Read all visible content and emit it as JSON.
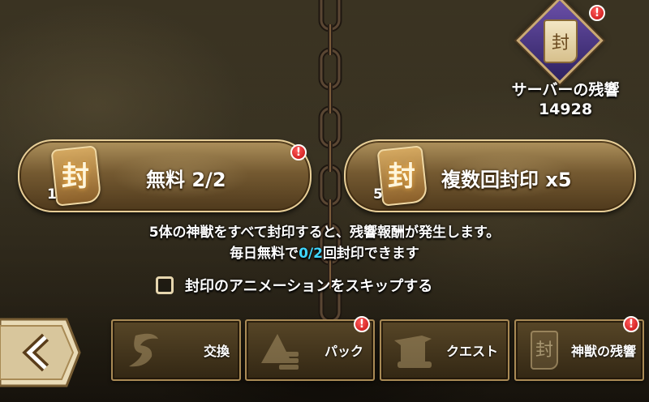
{
  "emblem": {
    "title": "サーバーの残響",
    "count": "14928",
    "kanji": "封",
    "alert": "!"
  },
  "seal_buttons": [
    {
      "label": "無料 2/2",
      "count": "1",
      "kanji": "封",
      "alert": "!"
    },
    {
      "label": "複数回封印 x5",
      "count": "5",
      "kanji": "封"
    }
  ],
  "info": {
    "line1": "5体の神獣をすべて封印すると、残響報酬が発生します。",
    "line2_prefix": "毎日無料で",
    "line2_highlight": "0/2",
    "line2_suffix": "回封印できます"
  },
  "skip_animation": {
    "label": "封印のアニメーションをスキップする",
    "checked": false
  },
  "bottom_tabs": [
    {
      "label": "交換",
      "icon": "exchange-icon",
      "alert": ""
    },
    {
      "label": "パック",
      "icon": "pack-icon",
      "alert": "!"
    },
    {
      "label": "クエスト",
      "icon": "quest-icon",
      "alert": ""
    },
    {
      "label": "神獣の残響",
      "icon": "beast-echo-icon",
      "kanji": "封",
      "alert": "!"
    }
  ],
  "colors": {
    "accent_gold": "#e8cf98",
    "highlight_cyan": "#3fd6ff",
    "alert_red": "#d81818",
    "emblem_purple": "#4b3788"
  }
}
